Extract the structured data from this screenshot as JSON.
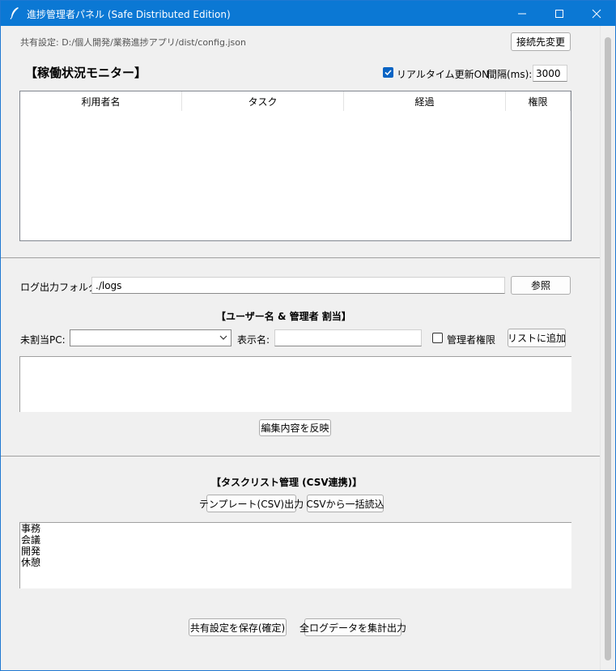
{
  "window": {
    "title": "進捗管理者パネル (Safe Distributed Edition)"
  },
  "config": {
    "path_label": "共有設定: D:/個人開発/業務進捗アプリ/dist/config.json",
    "change_button": "接続先変更"
  },
  "monitor": {
    "title": "【稼働状況モニター】",
    "realtime_label": "リアルタイム更新ON",
    "realtime_checked": true,
    "interval_label": "間隔(ms):",
    "interval_value": "3000",
    "columns": [
      "利用者名",
      "タスク",
      "経過",
      "権限"
    ]
  },
  "log": {
    "label": "ログ出力フォルダ:",
    "value": "./logs",
    "browse_button": "参照"
  },
  "users": {
    "title": "【ユーザー名 & 管理者 割当】",
    "pc_label": "未割当PC:",
    "pc_value": "",
    "display_label": "表示名:",
    "display_value": "",
    "admin_label": "管理者権限",
    "admin_checked": false,
    "add_button": "リストに追加",
    "apply_button": "編集内容を反映"
  },
  "tasks": {
    "title": "【タスクリスト管理 (CSV連携)】",
    "template_button": "テンプレート(CSV)出力",
    "import_button": "CSVから一括読込",
    "items": [
      "事務",
      "会議",
      "開発",
      "休憩"
    ]
  },
  "footer": {
    "save_button": "共有設定を保存(確定)",
    "export_button": "全ログデータを集計出力"
  },
  "colors": {
    "titlebar": "#0b78d4",
    "checkbox_checked": "#0a64c4"
  }
}
